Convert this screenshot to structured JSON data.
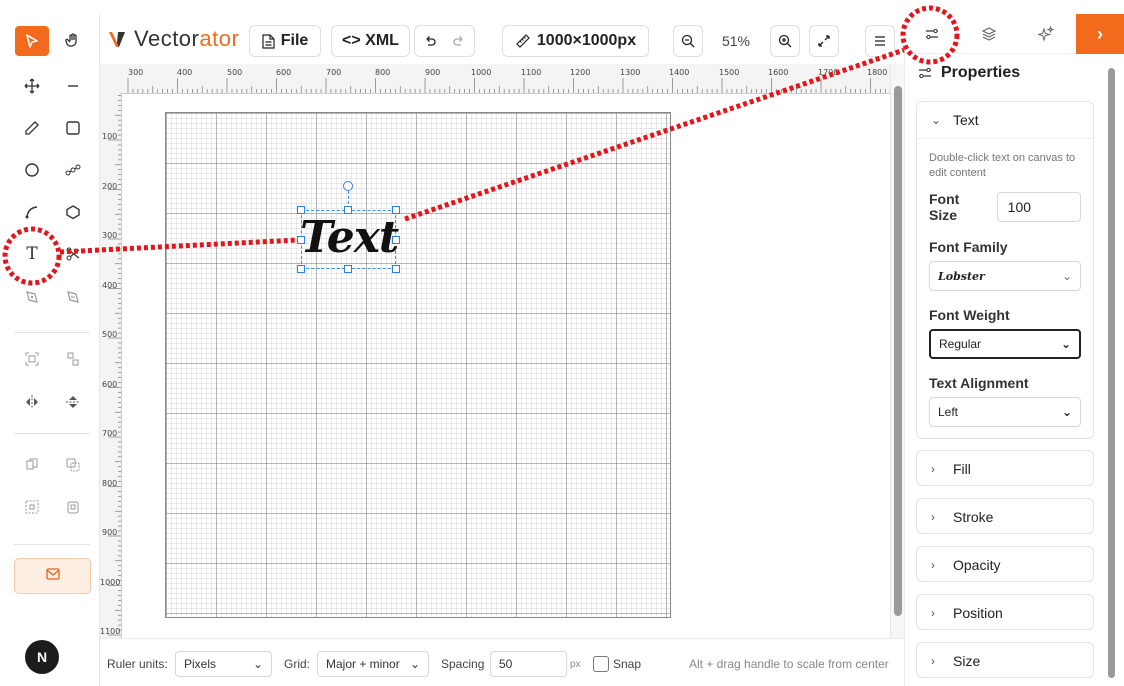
{
  "app": {
    "logo_prefix": "Vector",
    "logo_suffix": "ator"
  },
  "toolbar": {
    "file_label": "File",
    "xml_label": "<> XML",
    "size_label": "1000×1000px",
    "zoom_label": "51%"
  },
  "ruler": {
    "top_labels": [
      "300",
      "400",
      "500",
      "600",
      "700",
      "800",
      "900",
      "1000",
      "1100",
      "1200",
      "1300",
      "1400",
      "1500",
      "1600",
      "1700",
      "1800"
    ],
    "left_labels": [
      "100",
      "200",
      "300",
      "400",
      "500",
      "600",
      "700",
      "800",
      "900",
      "1000",
      "1100"
    ]
  },
  "canvas": {
    "selected_text": "Text"
  },
  "bottom": {
    "ruler_units_label": "Ruler units:",
    "ruler_units_value": "Pixels",
    "grid_label": "Grid:",
    "grid_value": "Major + minor",
    "spacing_label": "Spacing",
    "spacing_value": "50",
    "px_label": "px",
    "snap_label": "Snap",
    "hint": "Alt + drag handle to scale from center"
  },
  "panel": {
    "title": "Properties",
    "text_section": "Text",
    "hint": "Double-click text on canvas to edit content",
    "font_size_label": "Font Size",
    "font_size_value": "100",
    "font_family_label": "Font Family",
    "font_family_value": "Lobster",
    "font_weight_label": "Font Weight",
    "font_weight_value": "Regular",
    "text_align_label": "Text Alignment",
    "text_align_value": "Left",
    "sections": [
      "Fill",
      "Stroke",
      "Opacity",
      "Position",
      "Size"
    ]
  },
  "colors": {
    "accent": "#f26b1d",
    "selection": "#2f7fe0",
    "annotation": "#e4141b"
  },
  "icons": [
    "select-arrow-icon",
    "hand-icon",
    "move-icon",
    "minus-icon",
    "pen-icon",
    "rectangle-icon",
    "ellipse-icon",
    "path-nodes-icon",
    "curve-icon",
    "polygon-icon",
    "text-icon",
    "scissors-icon",
    "pen-add-icon",
    "pen-remove-icon",
    "group-icon",
    "ungroup-icon",
    "flip-horizontal-icon",
    "flip-vertical-icon",
    "duplicate-icon",
    "copy-icon",
    "select-frame-icon",
    "paste-icon",
    "mail-icon",
    "undo-icon",
    "redo-icon",
    "ruler-icon",
    "zoom-out-icon",
    "zoom-in-icon",
    "fullscreen-icon",
    "menu-icon",
    "properties-icon",
    "layers-icon",
    "sparkle-icon",
    "chevron-right-icon"
  ]
}
